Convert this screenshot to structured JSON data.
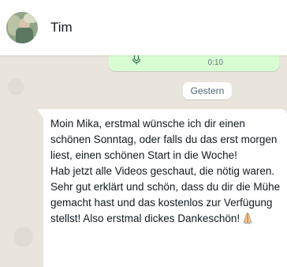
{
  "contact": {
    "name": "Tim"
  },
  "previous_message": {
    "time": "0:10"
  },
  "date_separator": {
    "label": "Gestern"
  },
  "message": {
    "text": "Moin Mika, erstmal wünsche ich dir einen schönen Sonntag, oder falls du das erst morgen liest, einen schönen Start in die Woche!\nHab jetzt alle Videos geschaut, die nötig waren. Sehr gut erklärt und schön, dass du dir die Mühe gemacht hast und das kostenlos zur Verfügung stellst! Also erstmal dickes Dankeschön!",
    "emoji_icon": "folded-hands-emoji"
  },
  "colors": {
    "outgoing_bubble": "#d9fdd3",
    "incoming_bubble": "#ffffff",
    "chat_background": "#e9e4dc"
  }
}
